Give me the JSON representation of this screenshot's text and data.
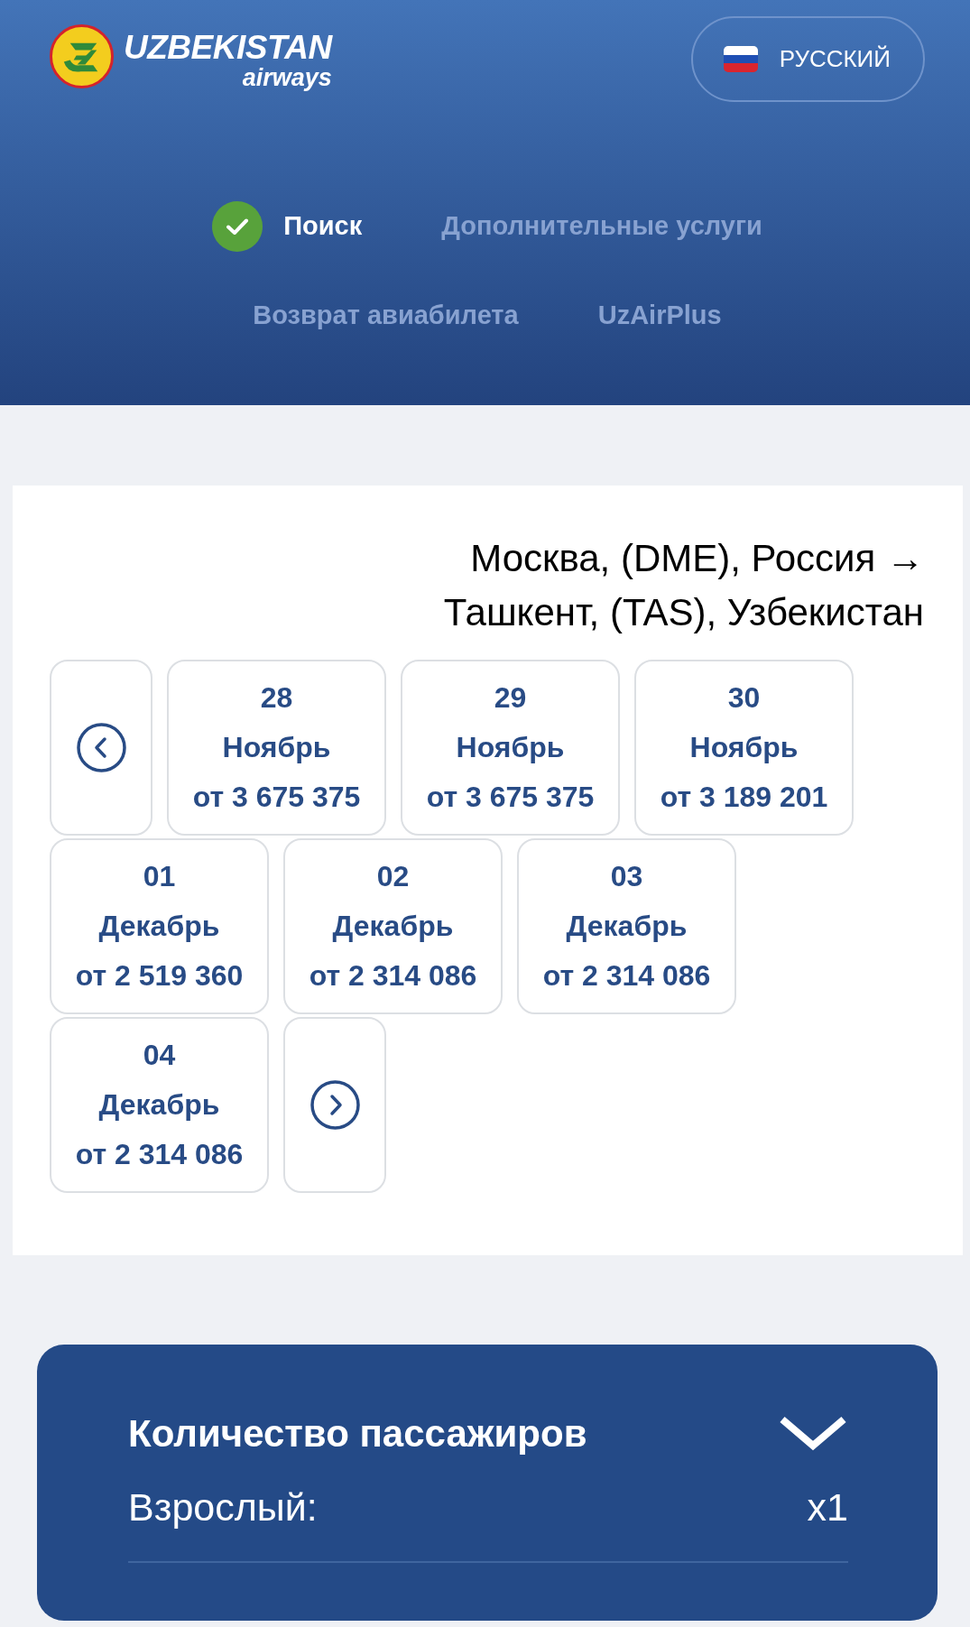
{
  "header": {
    "logo": {
      "name": "UZBEKISTAN",
      "tagline": "airways"
    },
    "language": {
      "label": "РУССКИЙ"
    }
  },
  "nav": {
    "items": [
      {
        "label": "Поиск",
        "selected": true
      },
      {
        "label": "Дополнительные услуги",
        "selected": false
      },
      {
        "label": "Возврат авиабилета",
        "selected": false
      },
      {
        "label": "UzAirPlus",
        "selected": false
      }
    ]
  },
  "route": {
    "text": "Москва, (DME), Россия → Ташкент, (TAS), Узбекистан"
  },
  "dates": {
    "items": [
      {
        "day": "28",
        "month": "Ноябрь",
        "price": "от 3 675 375"
      },
      {
        "day": "29",
        "month": "Ноябрь",
        "price": "от 3 675 375"
      },
      {
        "day": "30",
        "month": "Ноябрь",
        "price": "от 3 189 201"
      },
      {
        "day": "01",
        "month": "Декабрь",
        "price": "от 2 519 360"
      },
      {
        "day": "02",
        "month": "Декабрь",
        "price": "от 2 314 086"
      },
      {
        "day": "03",
        "month": "Декабрь",
        "price": "от 2 314 086"
      },
      {
        "day": "04",
        "month": "Декабрь",
        "price": "от 2 314 086"
      }
    ]
  },
  "passengers": {
    "title": "Количество пассажиров",
    "expanded": true,
    "rows": [
      {
        "label": "Взрослый:",
        "value": "x1"
      }
    ]
  }
}
